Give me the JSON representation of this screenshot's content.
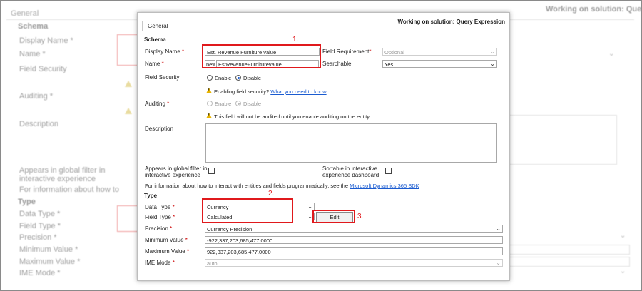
{
  "background": {
    "tab_label": "General",
    "solution": "Working on solution: Query Expression",
    "schema": "Schema",
    "display_name": "Display Name *",
    "name": "Name *",
    "field_security": "Field Security",
    "auditing": "Auditing *",
    "description": "Description",
    "appears_global_filter": "Appears in global filter in interactive experience",
    "info_text": "For information about how to",
    "type": "Type",
    "data_type": "Data Type *",
    "field_type": "Field Type *",
    "precision": "Precision *",
    "minimum_value": "Minimum Value *",
    "maximum_value": "Maximum Value *",
    "ime_mode": "IME Mode *"
  },
  "dialog": {
    "tab_label": "General",
    "solution": "Working on solution: Query Expression",
    "schema_heading": "Schema",
    "display_name": {
      "label": "Display Name",
      "value": "Est. Revenue Furniture value"
    },
    "field_requirement": {
      "label": "Field Requirement",
      "value": "Optional"
    },
    "name": {
      "label": "Name",
      "prefix": "new_",
      "value": "EstRevenueFurniturevalue"
    },
    "searchable": {
      "label": "Searchable",
      "value": "Yes"
    },
    "field_security": {
      "label": "Field Security",
      "enable": "Enable",
      "disable": "Disable",
      "selected": "Disable",
      "warning": "Enabling field security?",
      "warning_link": "What you need to know"
    },
    "auditing": {
      "label": "Auditing",
      "enable": "Enable",
      "disable": "Disable",
      "selected": "Disable",
      "warning": "This field will not be audited until you enable auditing on the entity."
    },
    "description": {
      "label": "Description",
      "value": ""
    },
    "global_filter": {
      "label_line1": "Appears in global filter in",
      "label_line2": "interactive experience",
      "checked": false
    },
    "sortable": {
      "label_line1": "Sortable in interactive",
      "label_line2": "experience dashboard",
      "checked": false
    },
    "info": {
      "text": "For information about how to interact with entities and fields programmatically, see the",
      "link": "Microsoft Dynamics 365 SDK"
    },
    "type_heading": "Type",
    "data_type": {
      "label": "Data Type",
      "value": "Currency"
    },
    "field_type": {
      "label": "Field Type",
      "value": "Calculated",
      "edit_button": "Edit"
    },
    "precision": {
      "label": "Precision",
      "value": "Currency Precision"
    },
    "minimum_value": {
      "label": "Minimum Value",
      "value": "-922,337,203,685,477.0000"
    },
    "maximum_value": {
      "label": "Maximum Value",
      "value": "922,337,203,685,477.0000"
    },
    "ime_mode": {
      "label": "IME Mode",
      "value": "auto"
    }
  },
  "annotations": {
    "one": "1.",
    "two": "2.",
    "three": "3."
  },
  "colors": {
    "annotation_red": "#e0191c",
    "link_blue": "#1a5bd0",
    "required_red": "#cc0000"
  }
}
